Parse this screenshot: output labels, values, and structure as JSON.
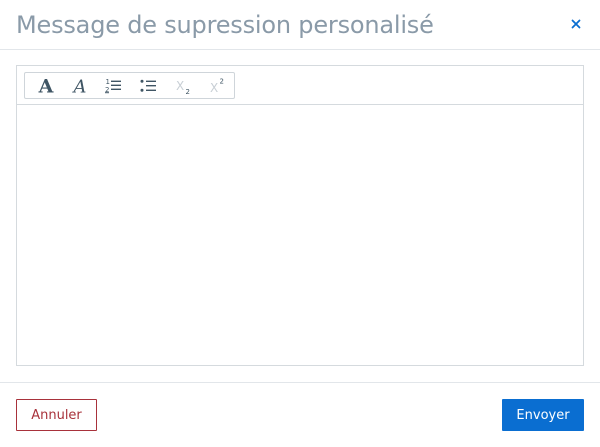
{
  "modal": {
    "title": "Message de supression personalisé",
    "close_icon": "close-icon"
  },
  "editor": {
    "toolbar": [
      {
        "name": "bold-icon",
        "glyph": "A",
        "enabled": true
      },
      {
        "name": "italic-icon",
        "glyph": "A",
        "enabled": true
      },
      {
        "name": "ordered-list-icon",
        "glyph": "1 2",
        "enabled": true
      },
      {
        "name": "unordered-list-icon",
        "glyph": "",
        "enabled": true
      },
      {
        "name": "subscript-icon",
        "glyph": "X2",
        "enabled": false
      },
      {
        "name": "superscript-icon",
        "glyph": "X2",
        "enabled": false
      }
    ],
    "content": ""
  },
  "footer": {
    "cancel_label": "Annuler",
    "send_label": "Envoyer"
  },
  "colors": {
    "title": "#8a9aa8",
    "accent": "#0a6ed1",
    "danger": "#a8323b",
    "icon_active": "#3f5564",
    "icon_disabled": "#c8cfd5",
    "border": "#d5dade"
  }
}
